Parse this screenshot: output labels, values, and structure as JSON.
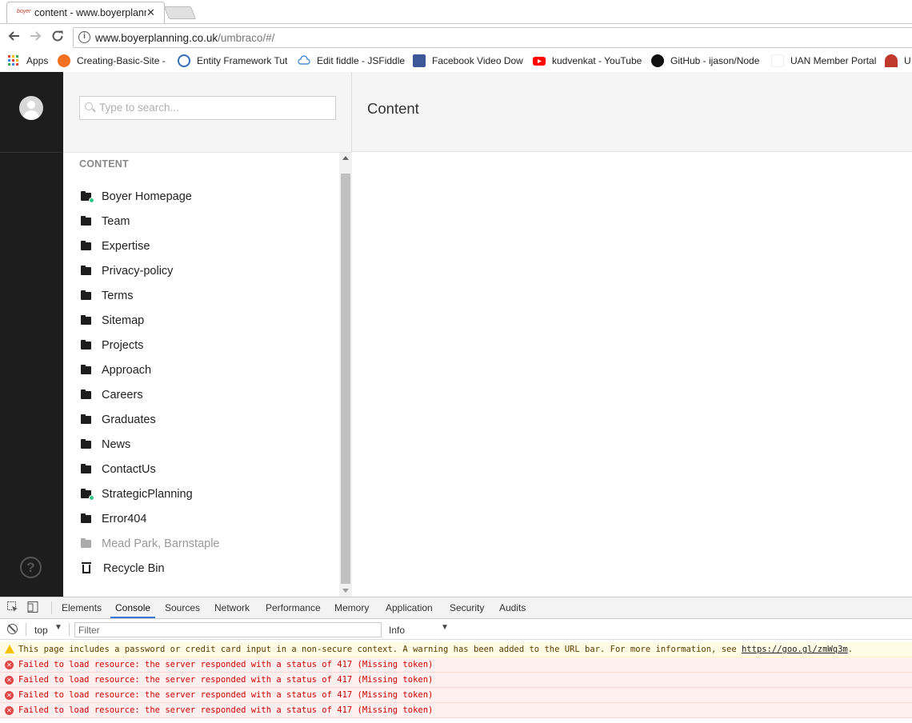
{
  "browser": {
    "tab": {
      "favicon_text": "boyer",
      "title": "content - www.boyerplanning.co.uk",
      "close": "✕"
    },
    "url_host": "www.boyerplanning.co.uk",
    "url_path": "/umbraco/#/",
    "bookmarks": [
      {
        "label": "Apps",
        "icon": "apps-grid-icon",
        "color": "#ea4335"
      },
      {
        "label": "Creating-Basic-Site -",
        "icon": "umbraco-icon",
        "color": "#f37021"
      },
      {
        "label": "Entity Framework Tut",
        "icon": "ef-icon",
        "color": "#2f6fb5"
      },
      {
        "label": "Edit fiddle - JSFiddle",
        "icon": "cloud-icon",
        "color": "#4a90d9"
      },
      {
        "label": "Facebook Video Dow",
        "icon": "fb-video-icon",
        "color": "#3b5998"
      },
      {
        "label": "kudvenkat - YouTube",
        "icon": "youtube-icon",
        "color": "#ff0000"
      },
      {
        "label": "GitHub - ijason/Node",
        "icon": "github-icon",
        "color": "#111111"
      },
      {
        "label": "UAN Member Portal",
        "icon": "blank-page-icon",
        "color": "#ffffff"
      },
      {
        "label": "U",
        "icon": "stamp-icon",
        "color": "#c0392b"
      }
    ]
  },
  "umbraco": {
    "search_placeholder": "Type to search...",
    "section_label": "CONTENT",
    "main_title": "Content",
    "help_glyph": "?",
    "tree": [
      {
        "label": "Boyer Homepage",
        "published_badge": true,
        "dim": false,
        "type": "folder"
      },
      {
        "label": "Team",
        "published_badge": false,
        "dim": false,
        "type": "folder"
      },
      {
        "label": "Expertise",
        "published_badge": false,
        "dim": false,
        "type": "folder"
      },
      {
        "label": "Privacy-policy",
        "published_badge": false,
        "dim": false,
        "type": "folder"
      },
      {
        "label": "Terms",
        "published_badge": false,
        "dim": false,
        "type": "folder"
      },
      {
        "label": "Sitemap",
        "published_badge": false,
        "dim": false,
        "type": "folder"
      },
      {
        "label": "Projects",
        "published_badge": false,
        "dim": false,
        "type": "folder"
      },
      {
        "label": "Approach",
        "published_badge": false,
        "dim": false,
        "type": "folder"
      },
      {
        "label": "Careers",
        "published_badge": false,
        "dim": false,
        "type": "folder"
      },
      {
        "label": "Graduates",
        "published_badge": false,
        "dim": false,
        "type": "folder"
      },
      {
        "label": "News",
        "published_badge": false,
        "dim": false,
        "type": "folder"
      },
      {
        "label": "ContactUs",
        "published_badge": false,
        "dim": false,
        "type": "folder"
      },
      {
        "label": "StrategicPlanning",
        "published_badge": true,
        "dim": false,
        "type": "folder"
      },
      {
        "label": "Error404",
        "published_badge": false,
        "dim": false,
        "type": "folder"
      },
      {
        "label": "Mead Park, Barnstaple",
        "published_badge": false,
        "dim": true,
        "type": "folder"
      },
      {
        "label": "Recycle Bin",
        "published_badge": false,
        "dim": false,
        "type": "bin"
      }
    ]
  },
  "devtools": {
    "tabs": [
      {
        "label": "Elements",
        "active": false
      },
      {
        "label": "Console",
        "active": true
      },
      {
        "label": "Sources",
        "active": false
      },
      {
        "label": "Network",
        "active": false
      },
      {
        "label": "Performance",
        "active": false
      },
      {
        "label": "Memory",
        "active": false
      },
      {
        "label": "Application",
        "active": false
      },
      {
        "label": "Security",
        "active": false
      },
      {
        "label": "Audits",
        "active": false
      }
    ],
    "context": "top",
    "filter_placeholder": "Filter",
    "level": "Info",
    "messages": [
      {
        "level": "warn",
        "text": "This page includes a password or credit card input in a non-secure context. A warning has been added to the URL bar. For more information, see ",
        "link": "https://goo.gl/zmWq3m",
        "suffix": "."
      },
      {
        "level": "err",
        "text": "Failed to load resource: the server responded with a status of 417 (Missing token)"
      },
      {
        "level": "err",
        "text": "Failed to load resource: the server responded with a status of 417 (Missing token)"
      },
      {
        "level": "err",
        "text": "Failed to load resource: the server responded with a status of 417 (Missing token)"
      },
      {
        "level": "err",
        "text": "Failed to load resource: the server responded with a status of 417 (Missing token)"
      }
    ]
  }
}
